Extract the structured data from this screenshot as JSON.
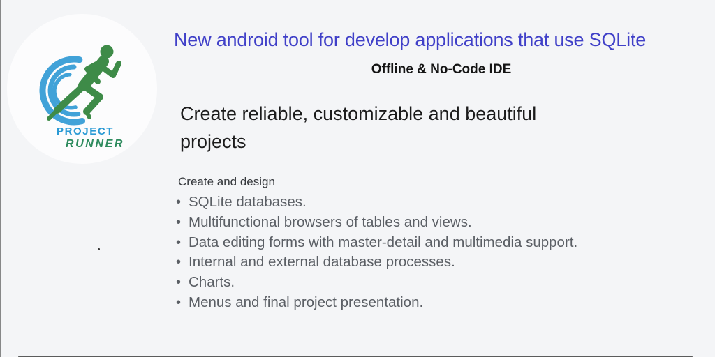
{
  "page": {
    "background_color": "#f4f5f7"
  },
  "logo": {
    "project_label": "PROJECT",
    "runner_label": "RUNNER",
    "project_color": "#2a9ad5",
    "runner_color": "#2e8b5e",
    "figure_green": "#3e8b48",
    "swoosh_blue": "#41a2d8",
    "circle_color": "#fcfcfd"
  },
  "header": {
    "title": "New android tool for develop applications that use SQLite",
    "title_color": "#4040c8",
    "subtitle": "Offline & No-Code IDE"
  },
  "main": {
    "heading": "Create reliable, customizable and beautiful projects",
    "list_intro": "Create and design",
    "bullet_glyph": "•",
    "features": [
      "SQLite databases.",
      "Multifunctional browsers of tables and views.",
      "Data editing forms with master-detail and multimedia support.",
      "Internal and external database processes.",
      "Charts.",
      "Menus and final project presentation."
    ],
    "text_color": "#5b5f65"
  }
}
